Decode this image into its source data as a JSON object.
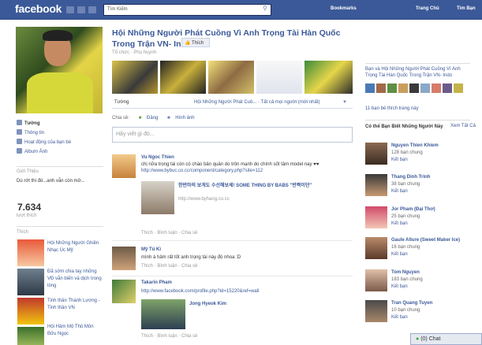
{
  "topbar": {
    "logo": "facebook",
    "search_value": "Tìm Kiếm",
    "bookmarks": "Bookmarks",
    "user": "Trang Chủ",
    "home": "Tìm Bạn"
  },
  "left": {
    "nav": [
      "Tường",
      "Thông tin",
      "Hoạt động của bạn bè",
      "Album Ảnh"
    ],
    "intro_heading": "Giới Thiệu",
    "intro_text": "Dù rớt thi đó...anh vẫn còn mở...",
    "likes_count": "7.634",
    "likes_label": "lượt thích",
    "thich_heading": "Thích",
    "liked_pages": [
      "Hội Những Người Ghiền Nhạc Úc Mỹ",
      "Đã sớm chia tay những VĐ vắn biến và dịch trong lòng",
      "Tinh thần Thánh Lương - Tinh thần VN",
      "Hội Hâm Mộ Thủ Môn Bửu Ngọc"
    ]
  },
  "page": {
    "title": "Hội Những Người Phát Cuồng Vì Anh Trọng Tài Hàn Quốc Trong Trận VN- Indo",
    "like_button": "Thích",
    "meta": "Tổ chức · Phụ huynh"
  },
  "tabs": {
    "wall": "Tường",
    "filter": "Hội Những Người Phát Cuồ... · Tất cả mọi người (mới nhất)"
  },
  "share": {
    "label": "Chia sẻ:",
    "status": "Đăng",
    "photo": "Hình ảnh"
  },
  "composer_placeholder": "Hãy viết gì đó...",
  "posts": [
    {
      "name": "Vu Ngoc Thien",
      "text": "chị nữa trọng tài còn có cháo bản quân do trôn mạnh do chính sốt tâm model nay ♥♥",
      "link": "http://www.bybuc.co.cc/component/category.php?site=112",
      "sub_title": "한반마의 보게도 수선해보세! SOME THING BY BABS \"반짝이던\"",
      "sub_link": "http://www.byhang.co.cc",
      "meta": "Thích · Bình luận · Chia sẻ"
    },
    {
      "name": "Mỹ Tú Kì",
      "text": "mình à hâm rất tốt anh trọng tài này đó nhoa :D",
      "meta": "Thích · Bình luận · Chia sẻ"
    },
    {
      "name": "Takarin Pham",
      "link": "http://www.facebook.com/profile.php?id=15220&ref=wall",
      "sub_title": "Jong Hyeok Kim",
      "meta": "Thích · Bình luận · Chia sẻ"
    }
  ],
  "right": {
    "page_name": "Bạn và Hội Những Người Phát Cuồng Vì Anh Trọng Tài Hàn Quốc Trong Trận VN- Indo",
    "friends_like": "11 bạn bè thích trang này",
    "suggest_heading": "Có thể Bạn Biết Những Người Này",
    "see_all": "Xem Tất Cả",
    "suggestions": [
      {
        "name": "Nguyen Thien Khiem",
        "count": "128 bạn chung",
        "action": "Kết bạn"
      },
      {
        "name": "Thang Dinh Trinh",
        "count": "38 bạn chung",
        "action": "Kết bạn"
      },
      {
        "name": "Jor Pham (Đại Thơ)",
        "count": "25 bạn chung",
        "action": "Kết bạn"
      },
      {
        "name": "Gaule Allure (Sweet Maker Ice)",
        "count": "16 bạn chung",
        "action": "Kết bạn"
      },
      {
        "name": "Tom Nguyen",
        "count": "183 bạn chung",
        "action": "Kết bạn"
      },
      {
        "name": "Tran Quang Tuyen",
        "count": "10 bạn chung",
        "action": "Kết bạn"
      }
    ]
  },
  "chat": "(0) Chat"
}
